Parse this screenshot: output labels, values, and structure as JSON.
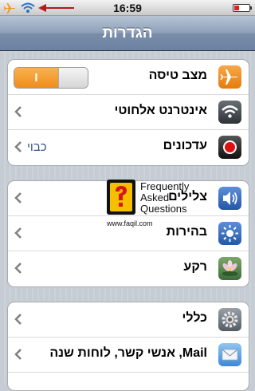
{
  "status_bar": {
    "time": "16:59"
  },
  "nav": {
    "title": "הגדרות"
  },
  "groups": [
    {
      "rows": [
        {
          "label": "מצב טיסה",
          "icon": "airplane-icon",
          "toggle_on_label": "I",
          "toggle_on": true
        },
        {
          "label": "אינטרנט אלחוטי",
          "icon": "wifi-icon"
        },
        {
          "label": "עדכונים",
          "icon": "record-icon",
          "value": "כבוי"
        }
      ]
    },
    {
      "rows": [
        {
          "label": "צלילים",
          "icon": "speaker-icon"
        },
        {
          "label": "בהירות",
          "icon": "sun-icon"
        },
        {
          "label": "רקע",
          "icon": "flower-icon"
        }
      ]
    },
    {
      "rows": [
        {
          "label": "כללי",
          "icon": "gear-icon"
        },
        {
          "label": "Mail, אנשי קשר, לוחות שנה",
          "icon": "mail-icon"
        }
      ]
    }
  ],
  "watermark": {
    "line1": "Frequently",
    "line2": "Asked",
    "line3": "Questions",
    "url": "www.faqil.com"
  },
  "colors": {
    "accent_toggle": "#f08d1a",
    "value_text": "#385487",
    "nav_bar": "#6c82a1"
  }
}
